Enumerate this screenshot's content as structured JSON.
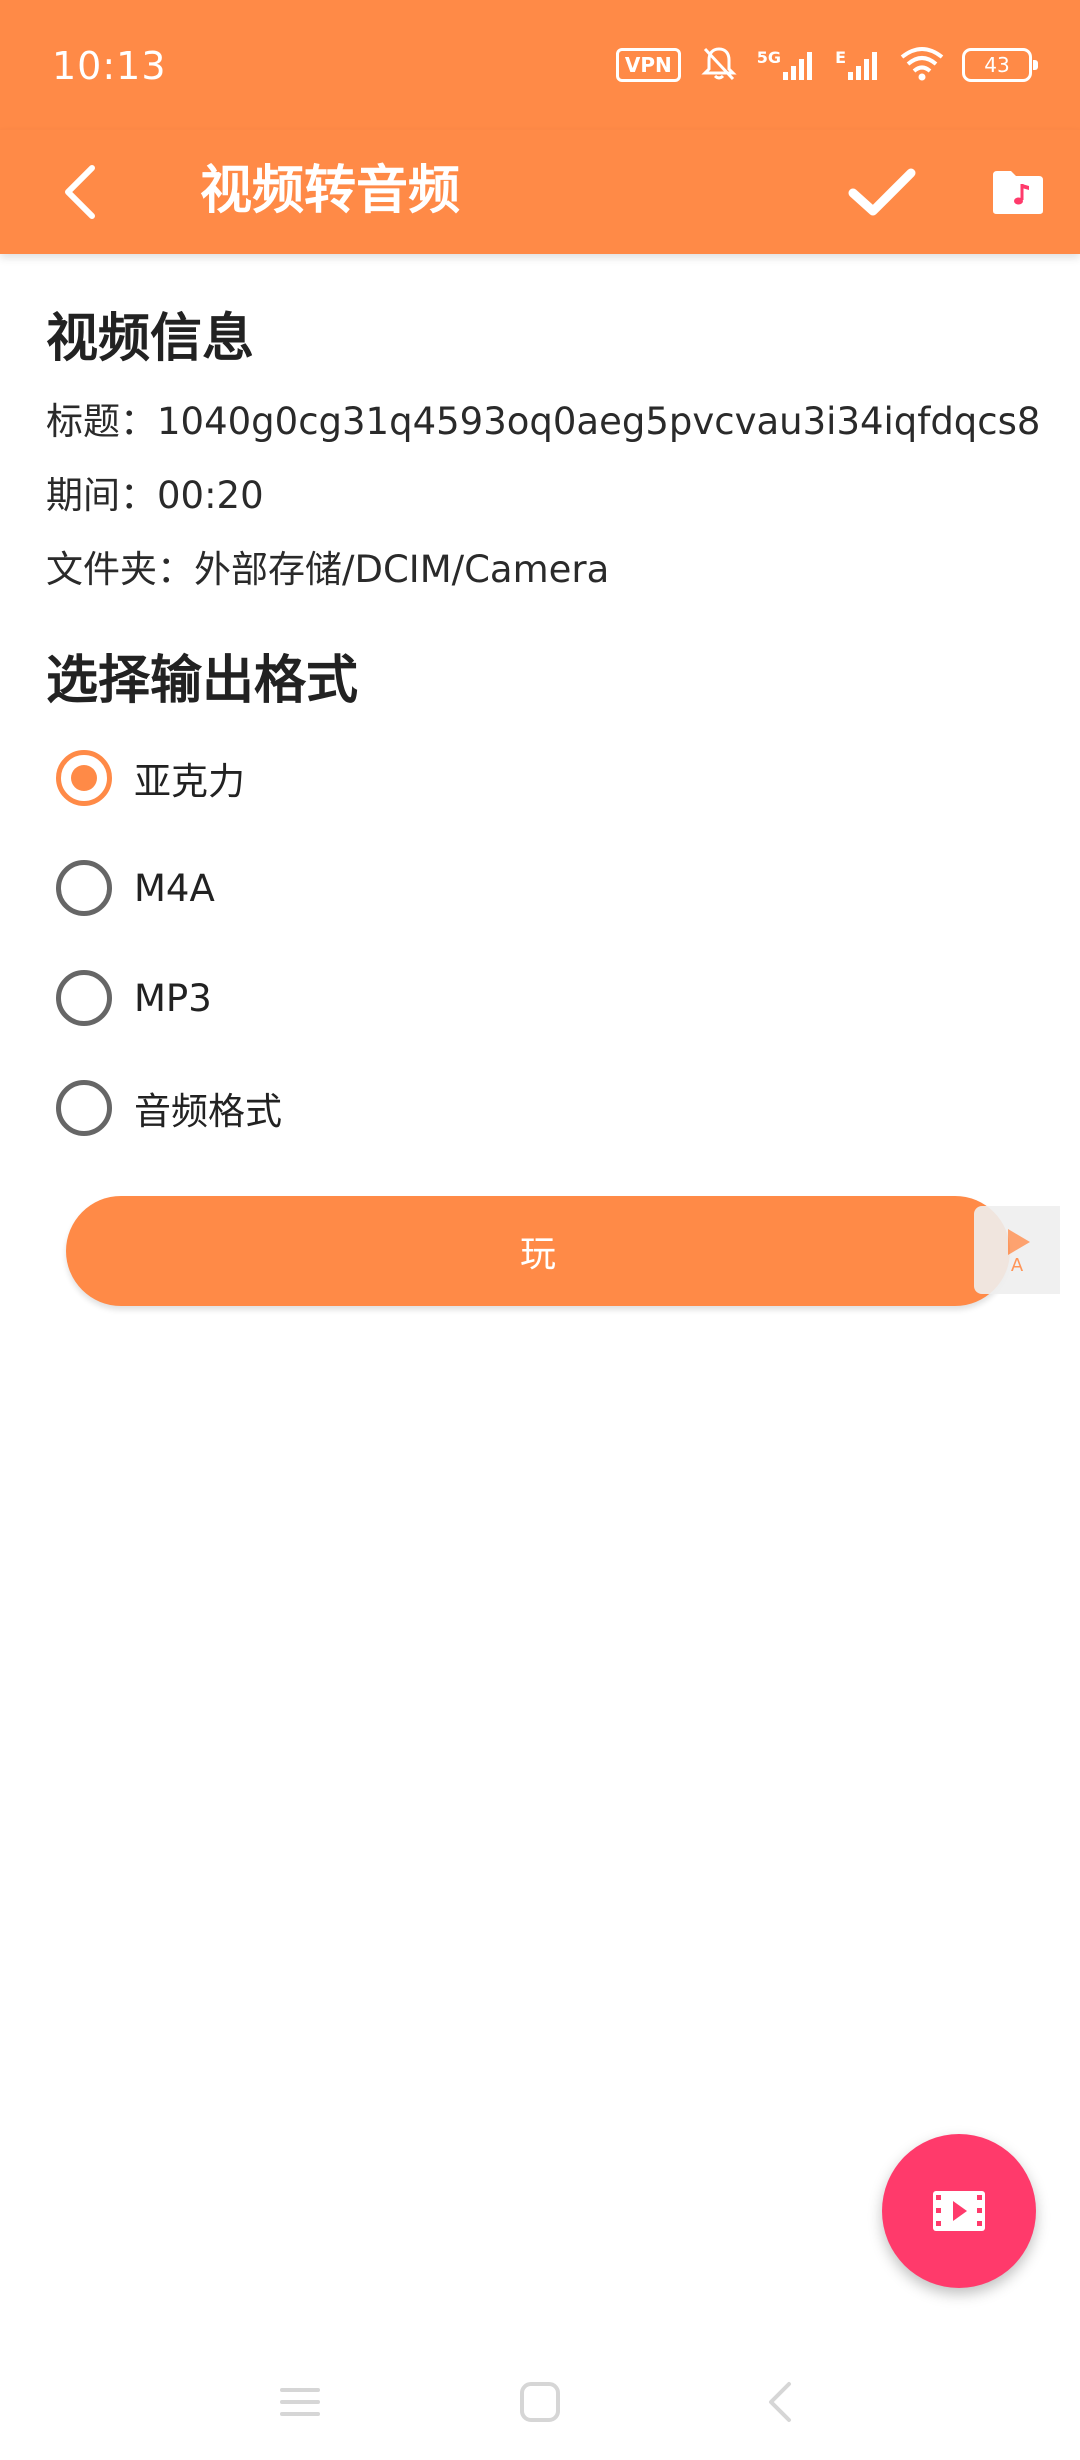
{
  "status_bar": {
    "time": "10:13",
    "vpn": "VPN",
    "network": "5G",
    "network2": "E",
    "battery": "43"
  },
  "app_bar": {
    "title": "视频转音频",
    "back_icon": "arrow-back-icon",
    "confirm_icon": "check-icon",
    "folder_icon": "music-folder-icon"
  },
  "video_info": {
    "heading": "视频信息",
    "title_row": "标题：1040g0cg31q4593oq0aeg5pvcvau3i34iqfdqcs8",
    "duration_row": "期间：00:20",
    "folder_row": "文件夹：外部存储/DCIM/Camera"
  },
  "output_format": {
    "heading": "选择输出格式",
    "options": [
      {
        "label": "亚克力",
        "selected": true
      },
      {
        "label": "M4A",
        "selected": false
      },
      {
        "label": "MP3",
        "selected": false
      },
      {
        "label": "音频格式",
        "selected": false
      }
    ]
  },
  "play_button": {
    "label": "玩"
  },
  "side_tab": {
    "label": "A",
    "icon": "play-triangle-icon"
  },
  "fab": {
    "icon": "video-file-icon"
  },
  "colors": {
    "accent": "#ff8a47",
    "fab": "#ff3a6b"
  },
  "nav_bar": {
    "icons": [
      "menu-icon",
      "home-square-icon",
      "back-chevron-icon"
    ]
  }
}
